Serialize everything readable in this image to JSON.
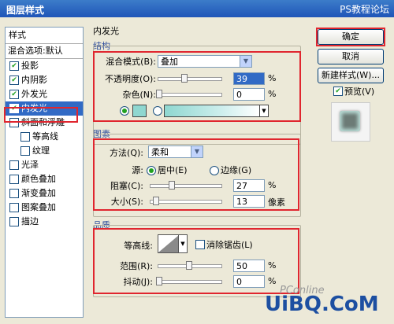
{
  "window": {
    "title": "图层样式",
    "watermark": "PS教程论坛"
  },
  "sidebar": {
    "header": "样式",
    "blend_options": "混合选项:默认",
    "items": [
      {
        "label": "投影",
        "checked": true
      },
      {
        "label": "内阴影",
        "checked": true
      },
      {
        "label": "外发光",
        "checked": true
      },
      {
        "label": "内发光",
        "checked": true,
        "active": true
      },
      {
        "label": "斜面和浮雕",
        "checked": false
      },
      {
        "label": "等高线",
        "checked": false,
        "sub": true
      },
      {
        "label": "纹理",
        "checked": false,
        "sub": true
      },
      {
        "label": "光泽",
        "checked": false
      },
      {
        "label": "颜色叠加",
        "checked": false
      },
      {
        "label": "渐变叠加",
        "checked": false
      },
      {
        "label": "图案叠加",
        "checked": false
      },
      {
        "label": "描边",
        "checked": false
      }
    ]
  },
  "panel": {
    "title": "内发光",
    "structure": {
      "label": "结构",
      "blend_mode_label": "混合模式(B):",
      "blend_mode_value": "叠加",
      "opacity_label": "不透明度(O):",
      "opacity_value": "39",
      "opacity_unit": "%",
      "noise_label": "杂色(N):",
      "noise_value": "0",
      "noise_unit": "%",
      "glow_color": "#8fd7d0"
    },
    "elements": {
      "label": "图素",
      "method_label": "方法(Q):",
      "method_value": "柔和",
      "source_label": "源:",
      "source_center": "居中(E)",
      "source_edge": "边缘(G)",
      "choke_label": "阻塞(C):",
      "choke_value": "27",
      "choke_unit": "%",
      "size_label": "大小(S):",
      "size_value": "13",
      "size_unit": "像素"
    },
    "quality": {
      "label": "品质",
      "contour_label": "等高线:",
      "antialias_label": "消除锯齿(L)",
      "range_label": "范围(R):",
      "range_value": "50",
      "range_unit": "%",
      "jitter_label": "抖动(J):",
      "jitter_value": "0",
      "jitter_unit": "%"
    }
  },
  "buttons": {
    "ok": "确定",
    "cancel": "取消",
    "new_style": "新建样式(W)...",
    "preview": "预览(V)"
  },
  "bottom_watermark": "UiBQ.CoM",
  "bottom_watermark_small": "PConline"
}
